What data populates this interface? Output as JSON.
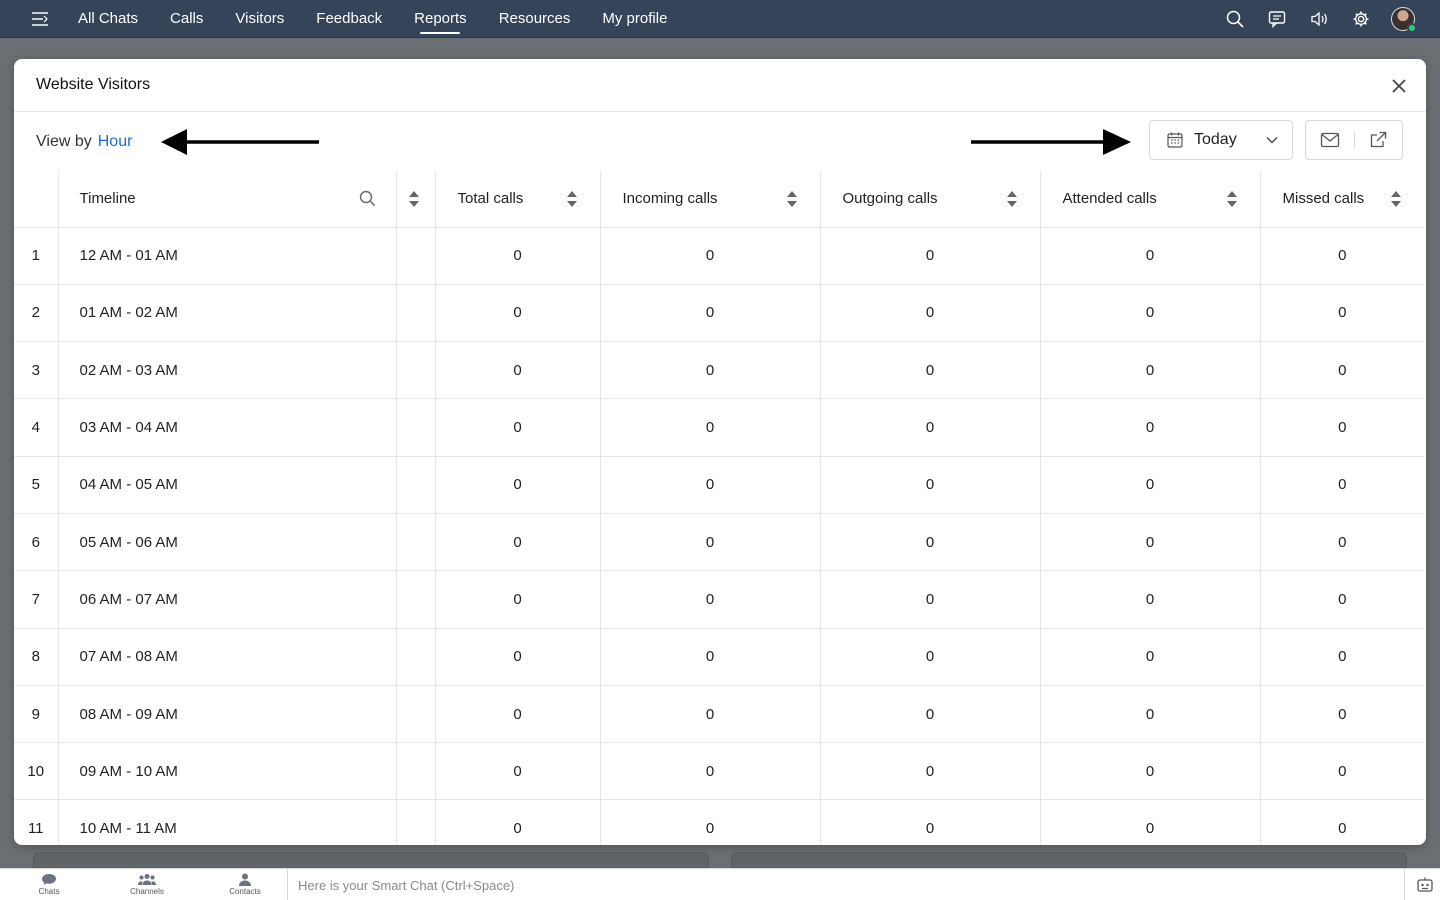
{
  "nav": {
    "items": [
      {
        "label": "All Chats",
        "active": false
      },
      {
        "label": "Calls",
        "active": false
      },
      {
        "label": "Visitors",
        "active": false
      },
      {
        "label": "Feedback",
        "active": false
      },
      {
        "label": "Reports",
        "active": true
      },
      {
        "label": "Resources",
        "active": false
      },
      {
        "label": "My profile",
        "active": false
      }
    ],
    "icons": [
      "search-icon",
      "message-icon",
      "speaker-icon",
      "gear-icon",
      "avatar"
    ]
  },
  "modal": {
    "title": "Website Visitors",
    "view_by_label": "View by",
    "view_by_value": "Hour",
    "date_range": "Today"
  },
  "table": {
    "columns": [
      "Timeline",
      "Total calls",
      "Incoming calls",
      "Outgoing calls",
      "Attended calls",
      "Missed calls"
    ],
    "rows": [
      {
        "idx": "1",
        "time": "12 AM - 01 AM",
        "total": "0",
        "incoming": "0",
        "outgoing": "0",
        "attended": "0",
        "missed": "0"
      },
      {
        "idx": "2",
        "time": "01 AM - 02 AM",
        "total": "0",
        "incoming": "0",
        "outgoing": "0",
        "attended": "0",
        "missed": "0"
      },
      {
        "idx": "3",
        "time": "02 AM - 03 AM",
        "total": "0",
        "incoming": "0",
        "outgoing": "0",
        "attended": "0",
        "missed": "0"
      },
      {
        "idx": "4",
        "time": "03 AM - 04 AM",
        "total": "0",
        "incoming": "0",
        "outgoing": "0",
        "attended": "0",
        "missed": "0"
      },
      {
        "idx": "5",
        "time": "04 AM - 05 AM",
        "total": "0",
        "incoming": "0",
        "outgoing": "0",
        "attended": "0",
        "missed": "0"
      },
      {
        "idx": "6",
        "time": "05 AM - 06 AM",
        "total": "0",
        "incoming": "0",
        "outgoing": "0",
        "attended": "0",
        "missed": "0"
      },
      {
        "idx": "7",
        "time": "06 AM - 07 AM",
        "total": "0",
        "incoming": "0",
        "outgoing": "0",
        "attended": "0",
        "missed": "0"
      },
      {
        "idx": "8",
        "time": "07 AM - 08 AM",
        "total": "0",
        "incoming": "0",
        "outgoing": "0",
        "attended": "0",
        "missed": "0"
      },
      {
        "idx": "9",
        "time": "08 AM - 09 AM",
        "total": "0",
        "incoming": "0",
        "outgoing": "0",
        "attended": "0",
        "missed": "0"
      },
      {
        "idx": "10",
        "time": "09 AM - 10 AM",
        "total": "0",
        "incoming": "0",
        "outgoing": "0",
        "attended": "0",
        "missed": "0"
      },
      {
        "idx": "11",
        "time": "10 AM - 11 AM",
        "total": "0",
        "incoming": "0",
        "outgoing": "0",
        "attended": "0",
        "missed": "0"
      }
    ]
  },
  "bottom": {
    "dock": [
      {
        "label": "Chats",
        "icon": "chat-bubble-icon"
      },
      {
        "label": "Channels",
        "icon": "group-icon"
      },
      {
        "label": "Contacts",
        "icon": "person-icon"
      }
    ],
    "smart_chat_placeholder": "Here is your Smart Chat (Ctrl+Space)"
  },
  "colors": {
    "topbar": "#354459",
    "link": "#1a6fd6",
    "backdrop": "#6b6f74"
  }
}
